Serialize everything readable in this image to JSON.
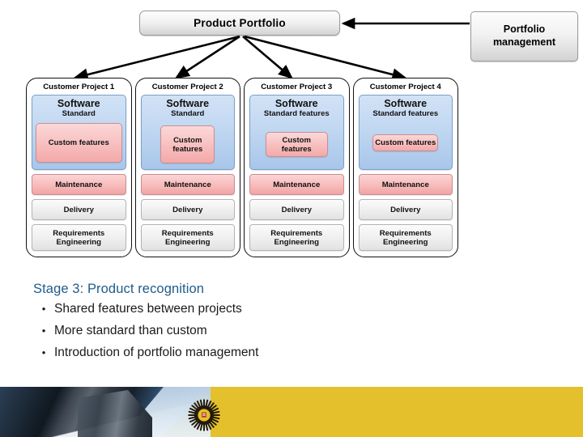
{
  "slide": {
    "top_box_label": "Product Portfolio",
    "side_box_label": "Portfolio management"
  },
  "columns": [
    {
      "title": "Customer Project 1",
      "software_title": "Software",
      "software_sub": "Standard",
      "custom_label": "Custom features",
      "custom_variant": "custom-v1",
      "bars": [
        {
          "label": "Maintenance",
          "style": "bar-pink"
        },
        {
          "label": "Delivery",
          "style": "bar-grey bar-delivery"
        },
        {
          "label": "Requirements Engineering",
          "style": "bar-grey bar-reqs"
        }
      ]
    },
    {
      "title": "Customer Project 2",
      "software_title": "Software",
      "software_sub": "Standard",
      "custom_label": "Custom features",
      "custom_variant": "custom-v2",
      "bars": [
        {
          "label": "Maintenance",
          "style": "bar-pink"
        },
        {
          "label": "Delivery",
          "style": "bar-grey bar-delivery"
        },
        {
          "label": "Requirements Engineering",
          "style": "bar-grey bar-reqs"
        }
      ]
    },
    {
      "title": "Customer Project 3",
      "software_title": "Software",
      "software_sub": "Standard features",
      "custom_label": "Custom features",
      "custom_variant": "custom-v3",
      "bars": [
        {
          "label": "Maintenance",
          "style": "bar-pink"
        },
        {
          "label": "Delivery",
          "style": "bar-grey bar-delivery"
        },
        {
          "label": "Requirements Engineering",
          "style": "bar-grey bar-reqs"
        }
      ]
    },
    {
      "title": "Customer Project 4",
      "software_title": "Software",
      "software_sub": "Standard features",
      "custom_label": "Custom features",
      "custom_variant": "custom-v4",
      "bars": [
        {
          "label": "Maintenance",
          "style": "bar-pink"
        },
        {
          "label": "Delivery",
          "style": "bar-grey bar-delivery"
        },
        {
          "label": "Requirements Engineering",
          "style": "bar-grey bar-reqs"
        }
      ]
    }
  ],
  "text_block": {
    "heading": "Stage 3: Product recognition",
    "bullet_char": "•",
    "bullets": [
      "Shared features between projects",
      "More standard than custom",
      "Introduction of portfolio management"
    ]
  },
  "footer": {
    "emblem_name": "university-sun-emblem",
    "yellow": "#E3C02C"
  },
  "colors": {
    "heading_blue": "#1F5C8B",
    "software_blue": "#A8C6EA",
    "custom_pink": "#F3A9A9",
    "bar_grey": "#E2E2E2",
    "connector_black": "#000000"
  }
}
